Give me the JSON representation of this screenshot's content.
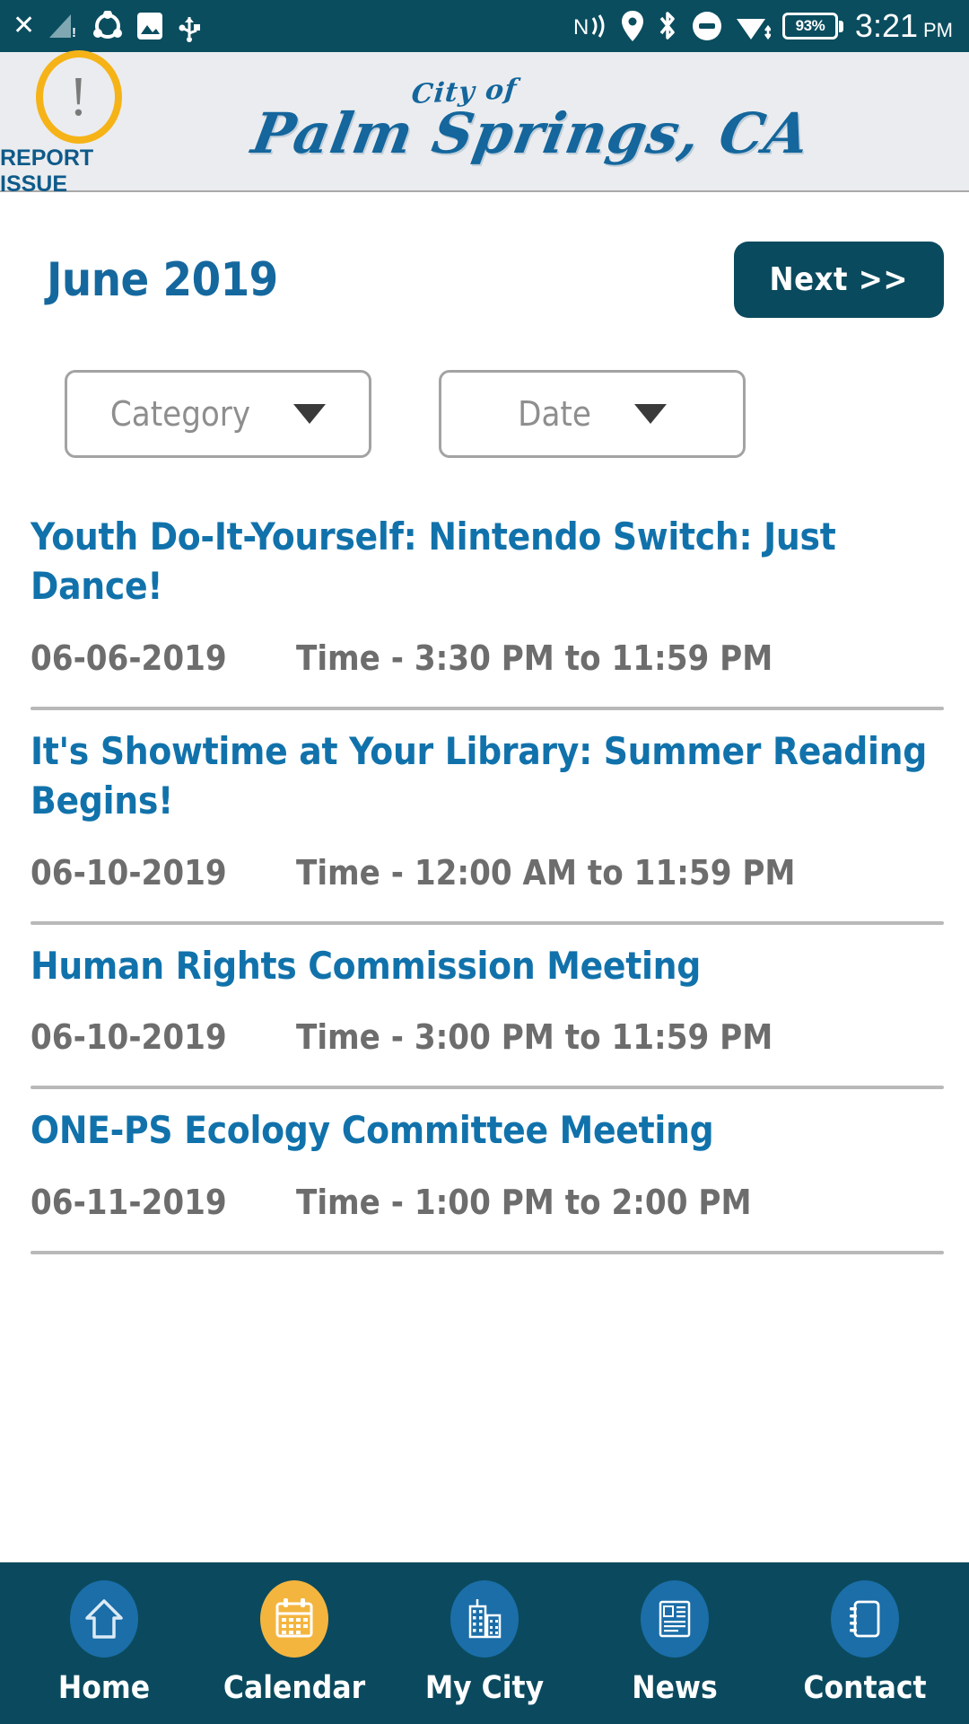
{
  "statusbar": {
    "left_icons": [
      "close-x-icon",
      "signal-warning-icon",
      "sync-icon",
      "image-icon",
      "usb-icon"
    ],
    "right_icons": [
      "nfc-icon",
      "location-icon",
      "bluetooth-icon",
      "do-not-disturb-icon",
      "wifi-icon"
    ],
    "battery_level": "93%",
    "time": "3:21",
    "meridiem": "PM"
  },
  "header": {
    "report_issue_label": "REPORT ISSUE",
    "report_issue_icon": "exclamation-circle-icon",
    "city_of": "City of",
    "city_name": "Palm Springs, CA"
  },
  "toolbar": {
    "month_title": "June 2019",
    "next_label": "Next >>"
  },
  "filters": [
    {
      "name": "category",
      "label": "Category",
      "icon": "chevron-down-icon"
    },
    {
      "name": "date",
      "label": "Date",
      "icon": "chevron-down-icon"
    }
  ],
  "events": [
    {
      "title": "Youth Do-It-Yourself: Nintendo Switch: Just Dance!",
      "date": "06-06-2019",
      "time": "Time - 3:30 PM to 11:59 PM"
    },
    {
      "title": "It's Showtime at Your Library: Summer Reading Begins!",
      "date": "06-10-2019",
      "time": "Time - 12:00 AM to 11:59 PM"
    },
    {
      "title": "Human Rights Commission Meeting",
      "date": "06-10-2019",
      "time": "Time - 3:00 PM to 11:59 PM"
    },
    {
      "title": "ONE-PS Ecology Committee Meeting",
      "date": "06-11-2019",
      "time": "Time - 1:00 PM to 2:00 PM"
    }
  ],
  "bottomnav": [
    {
      "label": "Home",
      "icon": "home-icon",
      "active": false
    },
    {
      "label": "Calendar",
      "icon": "calendar-icon",
      "active": true
    },
    {
      "label": "My City",
      "icon": "buildings-icon",
      "active": false
    },
    {
      "label": "News",
      "icon": "newspaper-icon",
      "active": false
    },
    {
      "label": "Contact",
      "icon": "contact-book-icon",
      "active": false
    }
  ],
  "colors": {
    "status_bar": "#0a4d5f",
    "header_bg": "#ebecef",
    "brand_blue": "#14669c",
    "accent_amber": "#f4b53f",
    "nav_bg": "#0b4a5e",
    "link_blue": "#1172ab",
    "next_btn": "#0a4a5e"
  }
}
